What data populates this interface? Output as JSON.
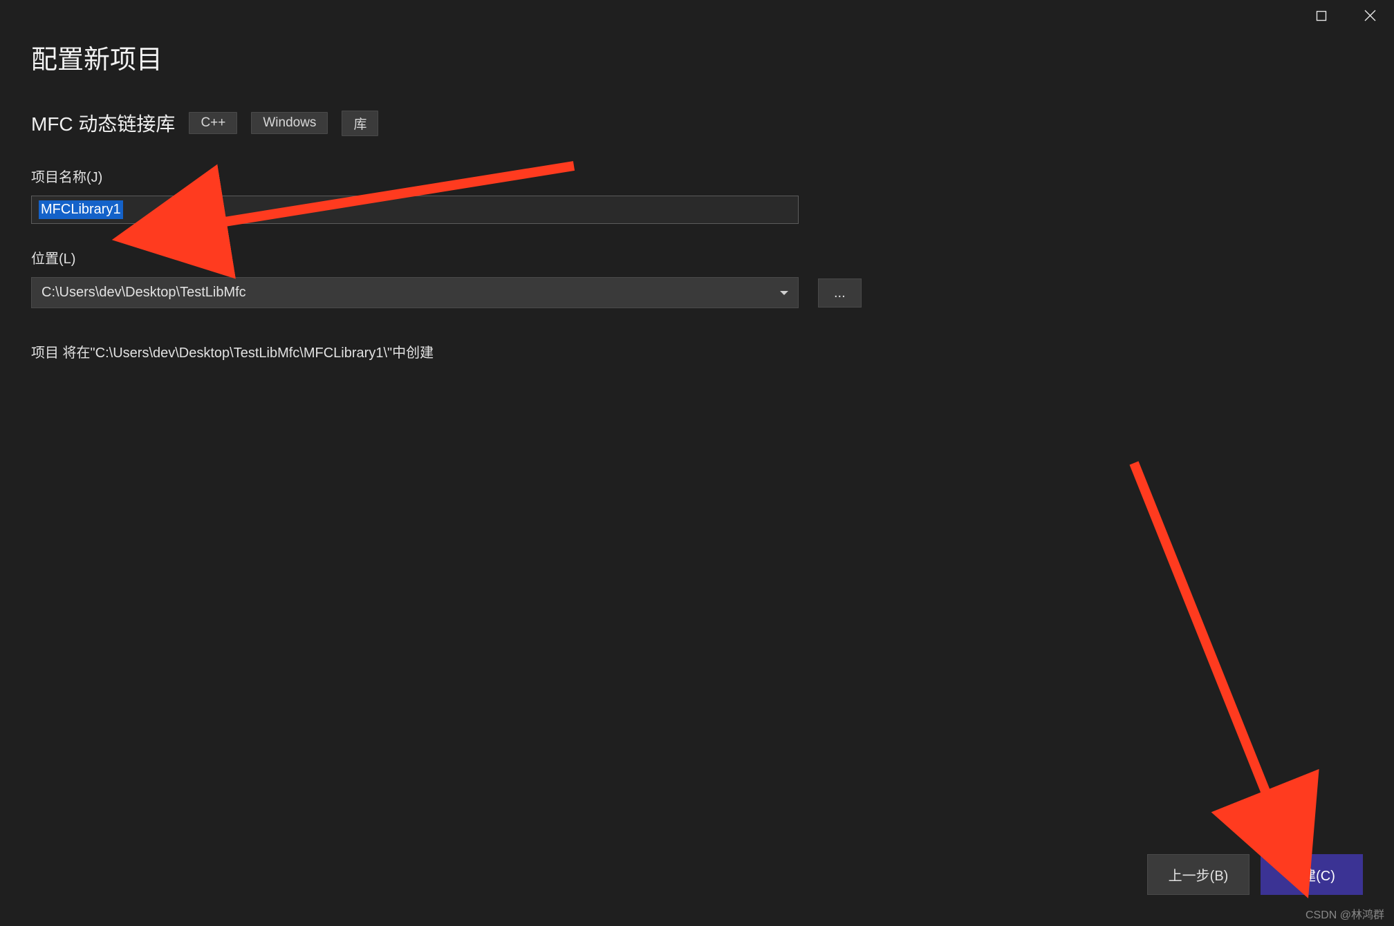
{
  "header": {
    "title": "配置新项目",
    "subtitle": "MFC 动态链接库",
    "tags": [
      "C++",
      "Windows",
      "库"
    ]
  },
  "fields": {
    "project_name": {
      "label": "项目名称(J)",
      "value": "MFCLibrary1"
    },
    "location": {
      "label": "位置(L)",
      "value": "C:\\Users\\dev\\Desktop\\TestLibMfc",
      "browse_label": "..."
    }
  },
  "info_text": "项目 将在\"C:\\Users\\dev\\Desktop\\TestLibMfc\\MFCLibrary1\\\"中创建",
  "footer": {
    "back_label": "上一步(B)",
    "create_label": "创建(C)"
  },
  "watermark": "CSDN @林鸿群"
}
